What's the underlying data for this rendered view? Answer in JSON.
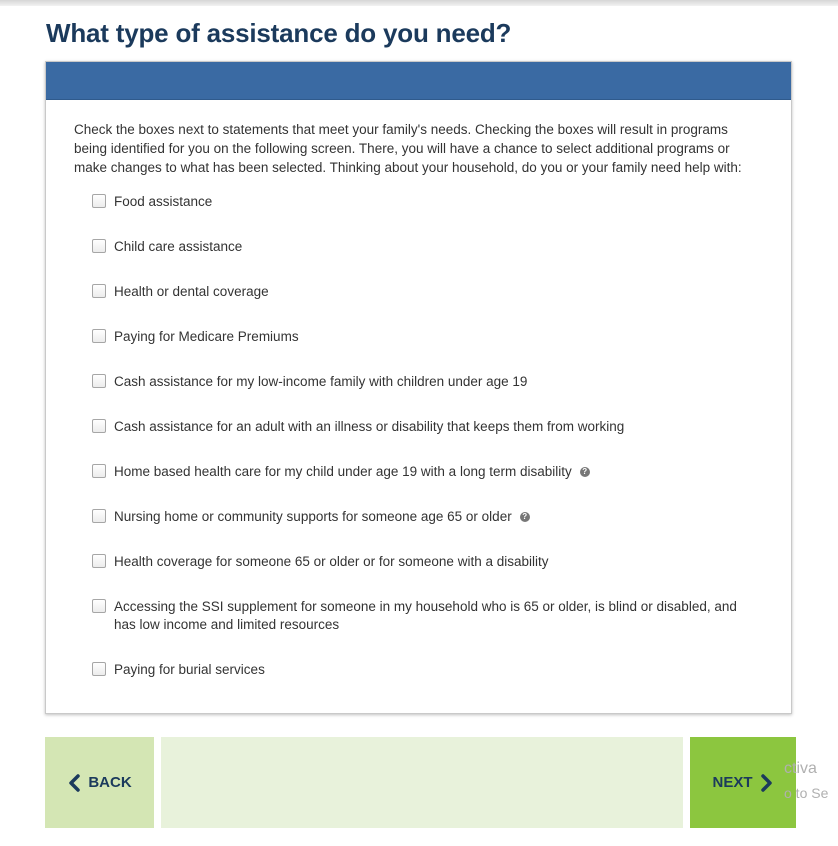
{
  "page": {
    "title": "What type of assistance do you need?"
  },
  "intro": {
    "text": "Check the boxes next to statements that meet your family's needs. Checking the boxes will result in programs being identified for you on the following screen. There, you will have a chance to select additional programs or make changes to what has been selected. Thinking about your household, do you or your family need help with:"
  },
  "options": [
    {
      "label": "Food assistance",
      "checked": false,
      "help": false
    },
    {
      "label": "Child care assistance",
      "checked": false,
      "help": false
    },
    {
      "label": "Health or dental coverage",
      "checked": false,
      "help": false
    },
    {
      "label": "Paying for Medicare Premiums",
      "checked": false,
      "help": false
    },
    {
      "label": "Cash assistance for my low-income family with children under age 19",
      "checked": false,
      "help": false
    },
    {
      "label": "Cash assistance for an adult with an illness or disability that keeps them from working",
      "checked": false,
      "help": false
    },
    {
      "label": "Home based health care for my child under age 19 with a long term disability",
      "checked": false,
      "help": true
    },
    {
      "label": "Nursing home or community supports for someone age 65 or older",
      "checked": false,
      "help": true
    },
    {
      "label": "Health coverage for someone 65 or older or for someone with a disability",
      "checked": false,
      "help": false
    },
    {
      "label": "Accessing the SSI supplement for someone in my household who is 65 or older, is blind or disabled, and has low income and limited resources",
      "checked": false,
      "help": false
    },
    {
      "label": "Paying for burial services",
      "checked": false,
      "help": false
    }
  ],
  "nav": {
    "back_label": "BACK",
    "next_label": "NEXT"
  },
  "watermark": {
    "line1": "ctiva",
    "line2": "o to Se"
  },
  "icons": {
    "back": "chevron-left-icon",
    "next": "chevron-right-icon",
    "help": "help-icon"
  },
  "colors": {
    "title": "#1b3a5c",
    "header_bar": "#3a6aa3",
    "back_bg": "#d4e6b4",
    "nav_spacer_bg": "#e8f2db",
    "next_bg": "#8cc63f"
  }
}
